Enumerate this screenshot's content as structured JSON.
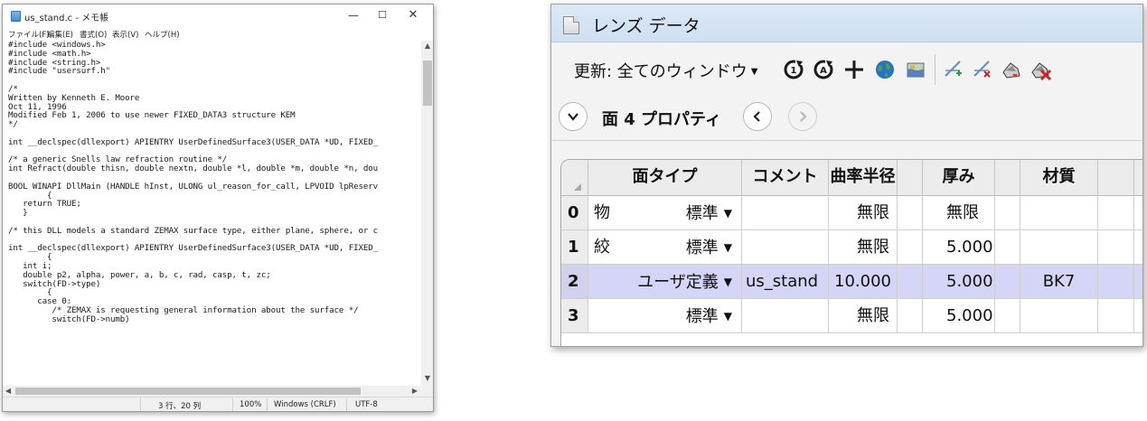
{
  "notepad": {
    "title": "us_stand.c - メモ帳",
    "menu": [
      "ファイル(F)",
      "編集(E)",
      "書式(O)",
      "表示(V)",
      "ヘルプ(H)"
    ],
    "lines": [
      "#include <windows.h>",
      "#include <math.h>",
      "#include <string.h>",
      "#include \"usersurf.h\"",
      "",
      "/*",
      "Written by Kenneth E. Moore",
      "Oct 11, 1996",
      "Modified Feb 1, 2006 to use newer FIXED_DATA3 structure KEM",
      "*/",
      "",
      "int __declspec(dllexport) APIENTRY UserDefinedSurface3(USER_DATA *UD, FIXED_",
      "",
      "/* a generic Snells law refraction routine */",
      "int Refract(double thisn, double nextn, double *l, double *m, double *n, dou",
      "",
      "BOOL WINAPI DllMain (HANDLE hInst, ULONG ul_reason_for_call, LPVOID lpReserv",
      "        {",
      "   return TRUE;",
      "   }",
      "",
      "/* this DLL models a standard ZEMAX surface type, either plane, sphere, or c",
      "",
      "int __declspec(dllexport) APIENTRY UserDefinedSurface3(USER_DATA *UD, FIXED_",
      "        {",
      "   int i;",
      "   double p2, alpha, power, a, b, c, rad, casp, t, zc;",
      "   switch(FD->type)",
      "        {",
      "      case 0:",
      "         /* ZEMAX is requesting general information about the surface */",
      "         switch(FD->numb)"
    ],
    "status": {
      "position": "3 行、20 列",
      "zoom": "100%",
      "line_ending": "Windows (CRLF)",
      "encoding": "UTF-8"
    }
  },
  "lens": {
    "title": "レンズ データ",
    "update_label": "更新: 全てのウィンドウ",
    "surface_label": "面  4 プロパティ",
    "headers": [
      "面タイプ",
      "コメント",
      "曲率半径",
      "厚み",
      "材質"
    ],
    "rows": [
      {
        "num": "0",
        "label": "物",
        "type": "標準",
        "comment": "",
        "radius": "無限",
        "thickness": "無限",
        "material": ""
      },
      {
        "num": "1",
        "label": "絞",
        "type": "標準",
        "comment": "",
        "radius": "無限",
        "thickness": "5.000",
        "material": ""
      },
      {
        "num": "2",
        "label": "",
        "type": "ユーザ定義",
        "comment": "us_stand",
        "radius": "10.000",
        "thickness": "5.000",
        "material": "BK7"
      },
      {
        "num": "3",
        "label": "",
        "type": "標準",
        "comment": "",
        "radius": "無限",
        "thickness": "5.000",
        "material": ""
      }
    ],
    "selected_row": 2
  }
}
